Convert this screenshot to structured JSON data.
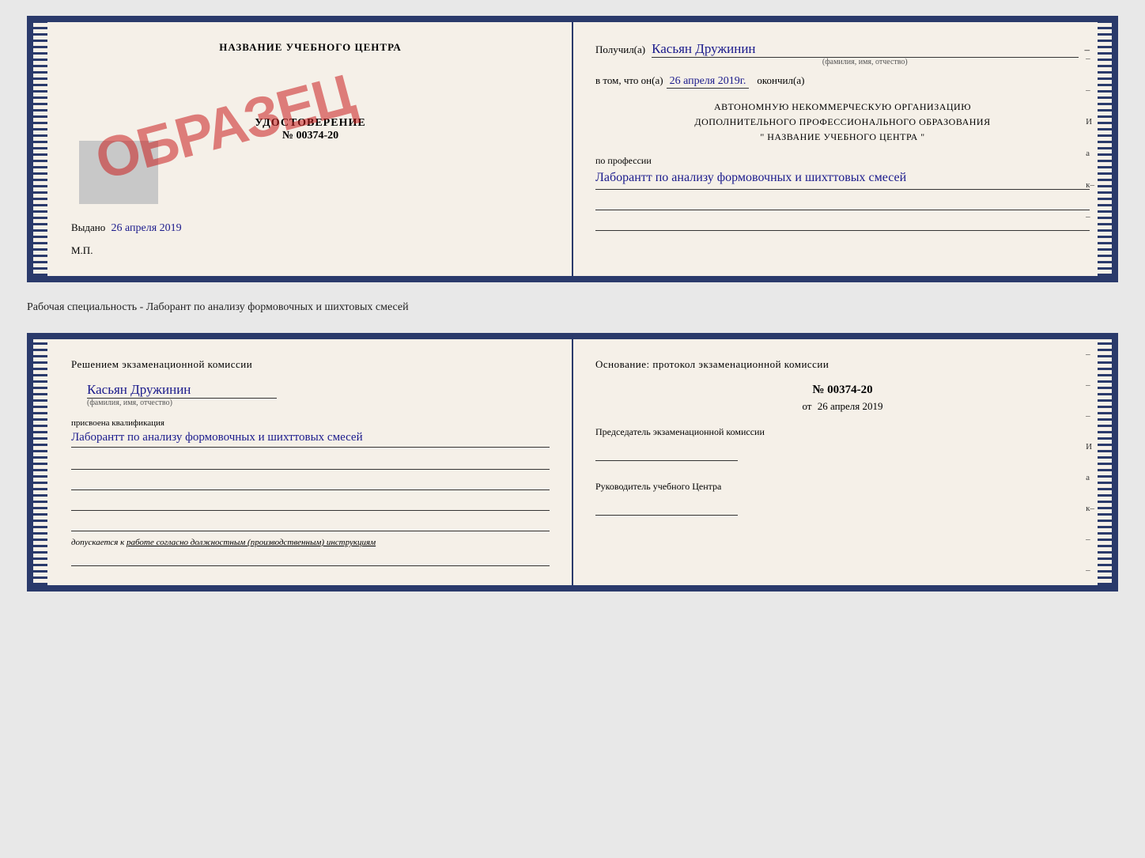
{
  "top_cert": {
    "left": {
      "title": "НАЗВАНИЕ УЧЕБНОГО ЦЕНТРА",
      "cert_label": "УДОСТОВЕРЕНИЕ",
      "cert_number": "№ 00374-20",
      "stamp_text": "ОБРАЗЕЦ",
      "vydano_label": "Выдано",
      "vydano_date": "26 апреля 2019",
      "mp": "М.П."
    },
    "right": {
      "poluchil_label": "Получил(а)",
      "poluchil_name": "Касьян Дружинин",
      "fio_label": "(фамилия, имя, отчество)",
      "vtom_label": "в том, что он(а)",
      "vtom_date": "26 апреля 2019г.",
      "okonchil": "окончил(а)",
      "org_line1": "АВТОНОМНУЮ НЕКОММЕРЧЕСКУЮ ОРГАНИЗАЦИЮ",
      "org_line2": "ДОПОЛНИТЕЛЬНОГО ПРОФЕССИОНАЛЬНОГО ОБРАЗОВАНИЯ",
      "org_quote": "\"  НАЗВАНИЕ УЧЕБНОГО ЦЕНТРА  \"",
      "prof_label": "по профессии",
      "prof_handwritten": "Лаборантт по анализу формовочных и шихттовых смесей",
      "side_chars": [
        "–",
        "–",
        "–",
        "И",
        "а",
        "к–",
        "–"
      ]
    }
  },
  "specialty_line": "Рабочая специальность - Лаборант по анализу формовочных и шихтовых смесей",
  "bottom_cert": {
    "left": {
      "title": "Решением экзаменационной комиссии",
      "name": "Касьян Дружинин",
      "fio_label": "(фамилия, имя, отчество)",
      "kvali_label": "присвоена квалификация",
      "kvali_handwritten": "Лаборантт по анализу формовочных и шихттовых смесей",
      "dopusk_label": "допускается к",
      "dopusk_text": "работе согласно должностным (производственным) инструкциям"
    },
    "right": {
      "osnov_label": "Основание: протокол экзаменационной комиссии",
      "protocol_number": "№ 00374-20",
      "ot_label": "от",
      "ot_date": "26 апреля 2019",
      "predsedatel_label": "Председатель экзаменационной комиссии",
      "ruk_label": "Руководитель учебного Центра",
      "side_chars": [
        "–",
        "–",
        "–",
        "И",
        "а",
        "к–",
        "–",
        "–"
      ]
    }
  }
}
